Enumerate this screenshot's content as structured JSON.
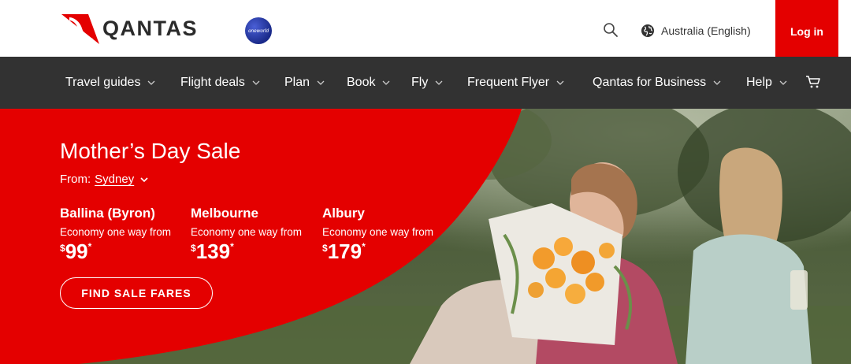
{
  "header": {
    "brand": "QANTAS",
    "alliance_badge": "oneworld",
    "search_icon": "search-icon",
    "language_label": "Australia (English)",
    "login_label": "Log in"
  },
  "nav": {
    "items": [
      {
        "label": "Travel guides"
      },
      {
        "label": "Flight deals"
      },
      {
        "label": "Plan"
      },
      {
        "label": "Book"
      },
      {
        "label": "Fly"
      },
      {
        "label": "Frequent Flyer"
      },
      {
        "label": "Qantas for Business"
      },
      {
        "label": "Help"
      }
    ],
    "cart_icon": "cart-icon"
  },
  "hero": {
    "title": "Mother’s Day Sale",
    "from_label": "From:",
    "from_city": "Sydney",
    "fares": [
      {
        "destination": "Ballina (Byron)",
        "cabin": "Economy one way from",
        "currency": "$",
        "price": "99",
        "footnote": "*"
      },
      {
        "destination": "Melbourne",
        "cabin": "Economy one way from",
        "currency": "$",
        "price": "139",
        "footnote": "*"
      },
      {
        "destination": "Albury",
        "cabin": "Economy one way from",
        "currency": "$",
        "price": "179",
        "footnote": "*"
      }
    ],
    "cta_label": "FIND SALE FARES"
  },
  "colors": {
    "brand_red": "#e40000",
    "nav_bg": "#323232",
    "text_dark": "#323232"
  }
}
